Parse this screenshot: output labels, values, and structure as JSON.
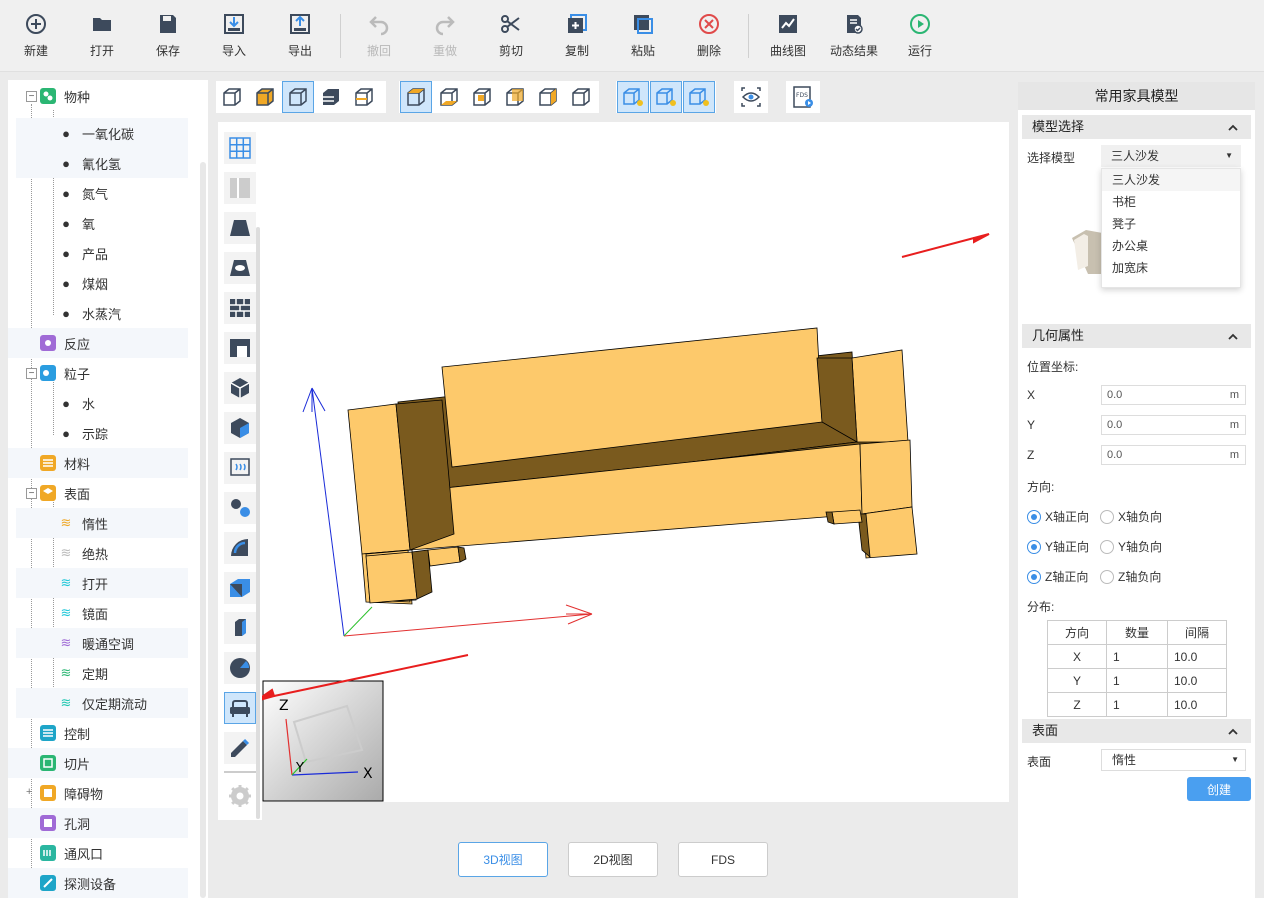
{
  "toolbar": {
    "new": "新建",
    "open": "打开",
    "save": "保存",
    "import": "导入",
    "export": "导出",
    "undo": "撤回",
    "redo": "重做",
    "cut": "剪切",
    "copy": "复制",
    "paste": "粘贴",
    "delete": "删除",
    "curve": "曲线图",
    "dynamic": "动态结果",
    "run": "运行"
  },
  "tree": {
    "species": "物种",
    "species_items": [
      "一氧化碳",
      "氰化氢",
      "氮气",
      "氧",
      "产品",
      "煤烟",
      "水蒸汽"
    ],
    "reaction": "反应",
    "particle": "粒子",
    "particle_items": [
      "水",
      "示踪"
    ],
    "material": "材料",
    "surface": "表面",
    "surface_items": [
      "惰性",
      "绝热",
      "打开",
      "镜面",
      "暖通空调",
      "定期",
      "仅定期流动"
    ],
    "control": "控制",
    "slice": "切片",
    "obstruction": "障碍物",
    "hole": "孔洞",
    "vent": "通风口",
    "device": "探测设备"
  },
  "tabs": {
    "view3d": "3D视图",
    "view2d": "2D视图",
    "fds": "FDS"
  },
  "gizmo": {
    "z": "Z",
    "y": "Y",
    "x": "X"
  },
  "panel": {
    "title": "常用家具模型",
    "model_section": "模型选择",
    "select_label": "选择模型",
    "select_value": "三人沙发",
    "options": [
      "三人沙发",
      "书柜",
      "凳子",
      "办公桌",
      "加宽床"
    ],
    "geom_section": "几何属性",
    "pos_label": "位置坐标:",
    "x_label": "X",
    "y_label": "Y",
    "z_label": "Z",
    "x_value": "0.0",
    "y_value": "0.0",
    "z_value": "0.0",
    "unit": "m",
    "dir_label": "方向:",
    "xpos": "X轴正向",
    "xneg": "X轴负向",
    "ypos": "Y轴正向",
    "yneg": "Y轴负向",
    "zpos": "Z轴正向",
    "zneg": "Z轴负向",
    "dist_label": "分布:",
    "dist_headers": [
      "方向",
      "数量",
      "间隔"
    ],
    "dist_rows": [
      [
        "X",
        "1",
        "10.0"
      ],
      [
        "Y",
        "1",
        "10.0"
      ],
      [
        "Z",
        "1",
        "10.0"
      ]
    ],
    "surface_section": "表面",
    "surface_label": "表面",
    "surface_value": "惰性",
    "create": "创建"
  },
  "colors": {
    "accent": "#3a8ee6",
    "sofa": "#fdc96b",
    "sofa_dark": "#7a5a1e"
  }
}
